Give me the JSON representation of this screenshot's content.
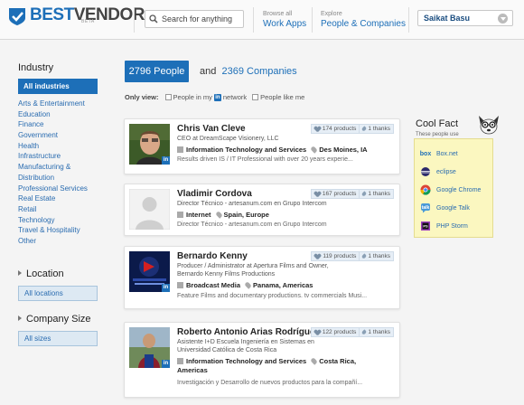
{
  "header": {
    "logo_best": "BEST",
    "logo_vendor": "VENDOR",
    "logo_beta": "BETA",
    "search_placeholder": "Search for anything",
    "browse_small": "Browse all",
    "browse_big": "Work Apps",
    "explore_small": "Explore",
    "explore_big": "People & Companies",
    "user_name": "Saikat Basu"
  },
  "sidebar": {
    "industry_heading": "Industry",
    "industry_selected": "All industries",
    "industries": [
      "Arts & Entertainment",
      "Education",
      "Finance",
      "Government",
      "Health",
      "Infrastructure",
      "Manufacturing &",
      "Distribution",
      "Professional Services",
      "Real Estate",
      "Retail",
      "Technology",
      "Travel & Hospitality",
      "Other"
    ],
    "location_heading": "Location",
    "location_value": "All locations",
    "size_heading": "Company Size",
    "size_value": "All sizes"
  },
  "counts": {
    "people": "2796 People",
    "and": "and",
    "companies": "2369 Companies"
  },
  "filters": {
    "label": "Only view:",
    "opt1_pre": "People in my",
    "opt1_icon": "in",
    "opt1_post": "network",
    "opt2": "People like me"
  },
  "people": [
    {
      "name": "Chris Van Cleve",
      "title": "CEO at DreamScape Visionery, LLC",
      "industry": "Information Technology and Services",
      "location": "Des Moines, IA",
      "desc": "Results driven IS / IT Professional with over 20 years experie...",
      "products": "174 products",
      "thanks": "1 thanks",
      "photo": "man-portrait"
    },
    {
      "name": "Vladimir Cordova",
      "title": "Director Técnico - artesanum.com en Grupo Intercom",
      "industry": "Internet",
      "location": "Spain, Europe",
      "desc": "Director Técnico - artesanum.com en Grupo Intercom",
      "products": "167 products",
      "thanks": "1 thanks",
      "photo": "default-avatar"
    },
    {
      "name": "Bernardo Kenny",
      "title": "Producer / Administrator at Apertura Films and Owner, Bernardo Kenny Films Productions",
      "industry": "Broadcast Media",
      "location": "Panama, Americas",
      "desc": "Feature Films and documentary productions. tv commercials Musi...",
      "products": "119 products",
      "thanks": "1 thanks",
      "photo": "film-logo"
    },
    {
      "name": "Roberto Antonio Arias Rodríguez",
      "title": "Asistente I+D Escuela Ingeniería en Sistemas en Universidad Católica de Costa Rica",
      "industry": "Information Technology and Services",
      "location": "Costa Rica,",
      "location2": "Americas",
      "desc": "Investigación y Desarrollo de nuevos productos para la compañí...",
      "products": "122 products",
      "thanks": "1 thanks",
      "photo": "man-outdoor"
    }
  ],
  "cool_fact": {
    "title": "Cool Fact",
    "subtitle": "These people use",
    "items": [
      {
        "label": "Box.net",
        "icon": "box"
      },
      {
        "label": "eclipse",
        "icon": "eclipse"
      },
      {
        "label": "Google Chrome",
        "icon": "chrome"
      },
      {
        "label": "Google Talk",
        "icon": "talk"
      },
      {
        "label": "PHP Storm",
        "icon": "phpstorm"
      }
    ]
  },
  "colors": {
    "accent": "#1d6fb8",
    "cool_bg": "#fbf7c0"
  }
}
